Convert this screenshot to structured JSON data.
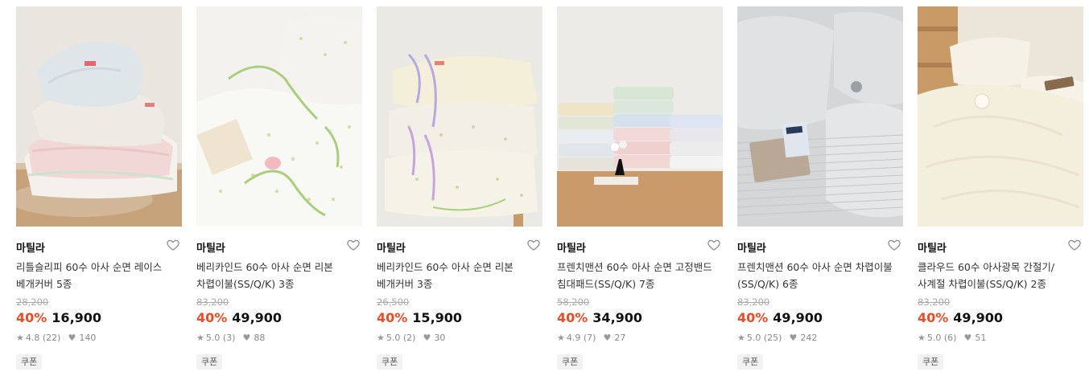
{
  "products": [
    {
      "brand": "마틸라",
      "name": "리틀슬리피 60수 아사 순면 레이스\n베개커버 5종",
      "original_price": "28,200",
      "discount": "40%",
      "price": "16,900",
      "rating": "4.8",
      "review_count": "(22)",
      "likes": "140",
      "badge": "쿠폰",
      "image": "lace-pillow-covers-photo"
    },
    {
      "brand": "마틸라",
      "name": "베리카인드 60수 아사 순면 리본\n차렵이불(SS/Q/K) 3종",
      "original_price": "83,200",
      "discount": "40%",
      "price": "49,900",
      "rating": "5.0",
      "review_count": "(3)",
      "likes": "88",
      "badge": "쿠폰",
      "image": "ribbon-comforter-photo"
    },
    {
      "brand": "마틸라",
      "name": "베리카인드 60수 아사 순면 리본\n베개커버 3종",
      "original_price": "26,500",
      "discount": "40%",
      "price": "15,900",
      "rating": "5.0",
      "review_count": "(2)",
      "likes": "30",
      "badge": "쿠폰",
      "image": "ribbon-pillow-covers-photo"
    },
    {
      "brand": "마틸라",
      "name": "프렌치맨션 60수 아사 순면 고정밴드\n침대패드(SS/Q/K) 7종",
      "original_price": "58,200",
      "discount": "40%",
      "price": "34,900",
      "rating": "4.9",
      "review_count": "(7)",
      "likes": "27",
      "badge": "쿠폰",
      "image": "folded-bed-pads-photo"
    },
    {
      "brand": "마틸라",
      "name": "프렌치맨션 60수 아사 순면 차렵이불\n(SS/Q/K) 6종",
      "original_price": "83,200",
      "discount": "40%",
      "price": "49,900",
      "rating": "5.0",
      "review_count": "(25)",
      "likes": "242",
      "badge": "쿠폰",
      "image": "gray-stripe-comforter-photo"
    },
    {
      "brand": "마틸라",
      "name": "클라우드 60수 아사광목 간절기/\n사계절 차렵이불(SS/Q/K) 2종",
      "original_price": "83,200",
      "discount": "40%",
      "price": "49,900",
      "rating": "5.0",
      "review_count": "(6)",
      "likes": "51",
      "badge": "쿠폰",
      "image": "cream-comforter-photo"
    }
  ],
  "colors": {
    "discount": "#f04a23",
    "badge_bg": "#f2f2f2"
  }
}
